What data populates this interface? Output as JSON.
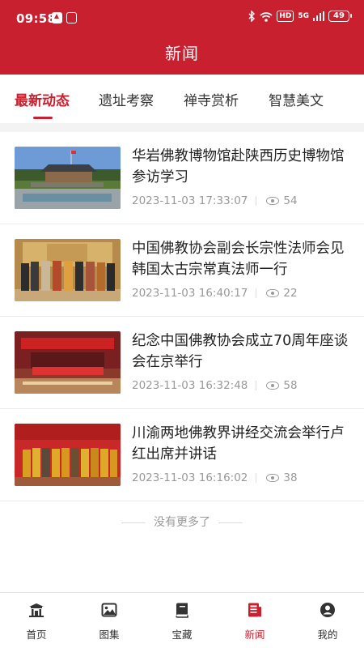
{
  "status_bar": {
    "time": "09:58",
    "battery": "49",
    "network": "5G",
    "hd": "HD"
  },
  "header": {
    "title": "新闻"
  },
  "tabs": [
    {
      "label": "最新动态",
      "active": true
    },
    {
      "label": "遗址考察",
      "active": false
    },
    {
      "label": "禅寺赏析",
      "active": false
    },
    {
      "label": "智慧美文",
      "active": false
    }
  ],
  "news": [
    {
      "title": "华岩佛教博物馆赴陕西历史博物馆参访学习",
      "datetime": "2023-11-03 17:33:07",
      "views": "54"
    },
    {
      "title": "中国佛教协会副会长宗性法师会见韩国太古宗常真法师一行",
      "datetime": "2023-11-03 16:40:17",
      "views": "22"
    },
    {
      "title": "纪念中国佛教协会成立70周年座谈会在京举行",
      "datetime": "2023-11-03 16:32:48",
      "views": "58"
    },
    {
      "title": "川渝两地佛教界讲经交流会举行卢红出席并讲话",
      "datetime": "2023-11-03 16:16:02",
      "views": "38"
    }
  ],
  "footer_text": "没有更多了",
  "bottom_nav": [
    {
      "label": "首页",
      "icon": "temple-icon",
      "active": false
    },
    {
      "label": "图集",
      "icon": "image-icon",
      "active": false
    },
    {
      "label": "宝藏",
      "icon": "book-icon",
      "active": false
    },
    {
      "label": "新闻",
      "icon": "news-icon",
      "active": true
    },
    {
      "label": "我的",
      "icon": "user-icon",
      "active": false
    }
  ],
  "colors": {
    "accent": "#c8202f",
    "muted": "#999999"
  }
}
